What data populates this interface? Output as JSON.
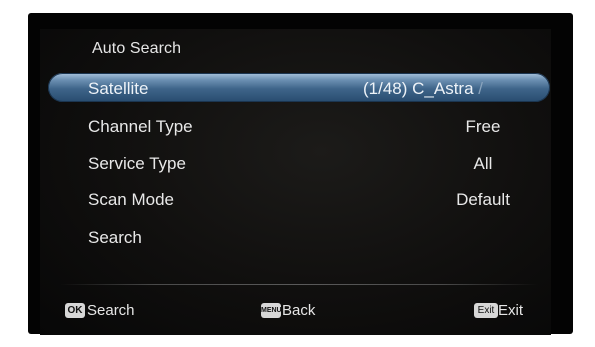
{
  "menu": {
    "title": "Auto Search",
    "rows": [
      {
        "label": "Satellite",
        "value": "(1/48) C_Astra",
        "value_fade": " /"
      },
      {
        "label": "Channel Type",
        "value": "Free"
      },
      {
        "label": "Service Type",
        "value": "All"
      },
      {
        "label": "Scan Mode",
        "value": "Default"
      },
      {
        "label": "Search",
        "value": ""
      }
    ],
    "selected_index": 0
  },
  "footer": {
    "hints": [
      {
        "key": "OK",
        "label": "Search"
      },
      {
        "key": "MENU",
        "label": "Back"
      },
      {
        "key": "Exit",
        "label": "Exit"
      }
    ]
  },
  "colors": {
    "selection_bar": "#3e6489",
    "text": "#e8e8e8",
    "background": "#030303"
  }
}
